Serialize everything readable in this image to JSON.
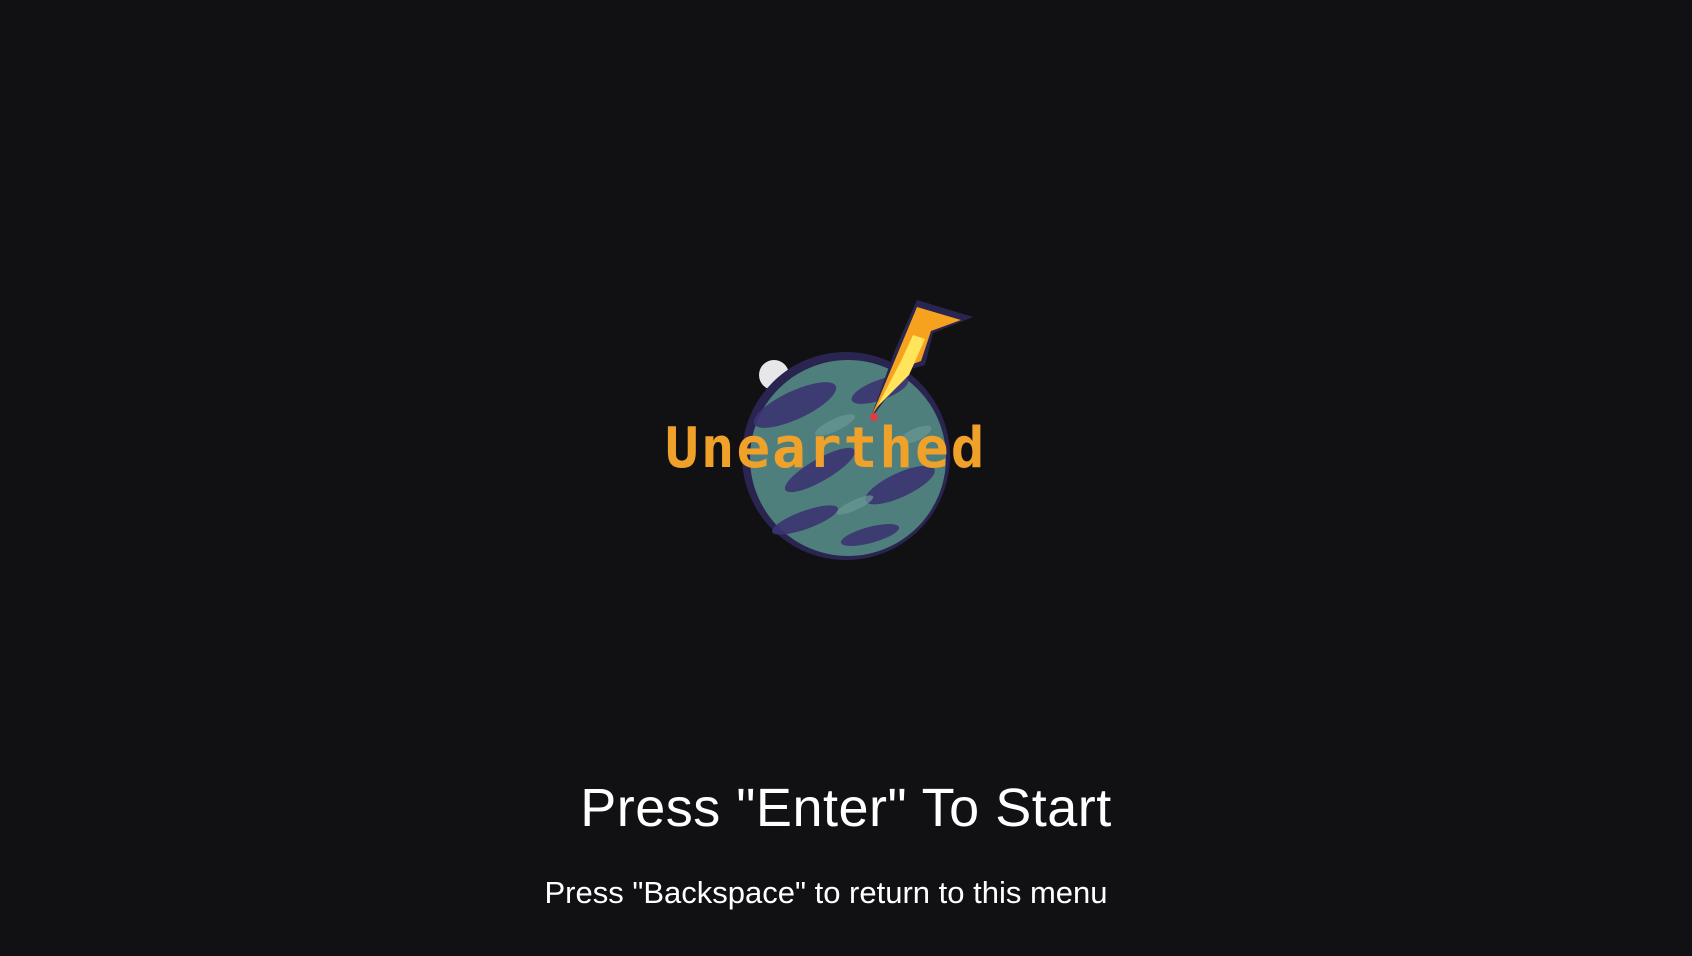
{
  "game": {
    "title": "Unearthed",
    "title_color": "#f0a12a",
    "background_color": "#111114"
  },
  "logo": {
    "planet_icon": "planet-icon",
    "moon_icon": "moon-icon",
    "meteor_icon": "meteor-icon",
    "planet_color": "#4f7f7c",
    "planet_shadow_color": "#3a3472",
    "meteor_color": "#f6a21e"
  },
  "menu": {
    "start_prompt": "Press \"Enter\" To Start",
    "back_hint": "Press \"Backspace\" to return to this menu"
  }
}
